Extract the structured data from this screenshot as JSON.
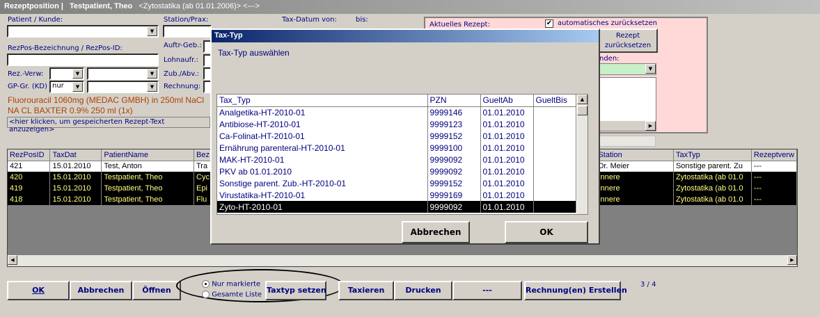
{
  "window": {
    "title": "Rezeptposition |",
    "patient": "Testpatient, Theo",
    "subtitle": "<Zytostatika (ab 01.01.2006)> <--->"
  },
  "form": {
    "patient_label": "Patient / Kunde:",
    "station_label": "Station/Prax:",
    "taxdatum_von_label": "Tax-Datum von:",
    "bis_label": "bis:",
    "rezpos_label": "RezPos-Bezeichnung / RezPos-ID:",
    "auftr_label": "Auftr-Geb.:",
    "lohnauf_label": "Lohnaufr.:",
    "rezverw_label": "Rez.-Verw:",
    "zubabv_label": "Zub./Abv.:",
    "gpgr_label": "GP-Gr. (KD)",
    "gpgr_value": "nur",
    "rechnung_label": "Rechnung:",
    "recipe_line1": "Fluorouracil 1060mg (MEDAC GMBH) in 250ml NaCl",
    "recipe_line2": "NA CL BAXTER 0.9% 250 ml (1x)",
    "hint": "<hier klicken, um gespeicherten Rezept-Text anzuzeigen>"
  },
  "pink": {
    "aktuelles": "Aktuelles Rezept:",
    "auto_reset": "automatisches zurücksetzen",
    "reset_btn_line1": "Rezept",
    "reset_btn_line2": "zurücksetzen",
    "nden": "nden:"
  },
  "table": {
    "headers": [
      "RezPosID",
      "TaxDat",
      "PatientName",
      "Bez",
      "Station",
      "TaxTyp",
      "Rezeptverw"
    ],
    "rows": [
      [
        "421",
        "15.01.2010",
        "Test, Anton",
        "Tra",
        "Dr. Meier",
        "Sonstige parent. Zu",
        "---"
      ],
      [
        "420",
        "15.01.2010",
        "Testpatient, Theo",
        "Cyc",
        "Innere",
        "Zytostatika (ab 01.0",
        "---"
      ],
      [
        "419",
        "15.01.2010",
        "Testpatient, Theo",
        "Epi",
        "Innere",
        "Zytostatika (ab 01.0",
        "---"
      ],
      [
        "418",
        "15.01.2010",
        "Testpatient, Theo",
        "Flu",
        "Innere",
        "Zytostatika (ab 01.0",
        "---"
      ]
    ]
  },
  "dialog": {
    "title": "Tax-Typ",
    "prompt": "Tax-Typ auswählen",
    "headers": [
      "Tax_Typ",
      "PZN",
      "GueltAb",
      "GueltBis"
    ],
    "rows": [
      [
        "Analgetika-HT-2010-01",
        "9999146",
        "01.01.2010",
        ""
      ],
      [
        "Antibiose-HT-2010-01",
        "9999123",
        "01.01.2010",
        ""
      ],
      [
        "Ca-Folinat-HT-2010-01",
        "9999152",
        "01.01.2010",
        ""
      ],
      [
        "Ernährung parenteral-HT-2010-01",
        "9999100",
        "01.01.2010",
        ""
      ],
      [
        "MAK-HT-2010-01",
        "9999092",
        "01.01.2010",
        ""
      ],
      [
        "PKV ab 01.01.2010",
        "9999092",
        "01.01.2010",
        ""
      ],
      [
        "Sonstige parent. Zub.-HT-2010-01",
        "9999152",
        "01.01.2010",
        ""
      ],
      [
        "Virustatika-HT-2010-01",
        "9999169",
        "01.01.2010",
        ""
      ],
      [
        "Zyto-HT-2010-01",
        "9999092",
        "01.01.2010",
        ""
      ]
    ],
    "cancel": "Abbrechen",
    "ok": "OK"
  },
  "bottom": {
    "ok": "OK",
    "abbrechen": "Abbrechen",
    "oeffnen": "Öffnen",
    "nur_markierte": "Nur markierte",
    "gesamte_liste": "Gesamte Liste",
    "taxtyp_setzen": "Taxtyp setzen",
    "taxieren": "Taxieren",
    "drucken": "Drucken",
    "dash": "---",
    "rechnung_erstellen": "Rechnung(en) Erstellen",
    "page": "3 / 4"
  }
}
